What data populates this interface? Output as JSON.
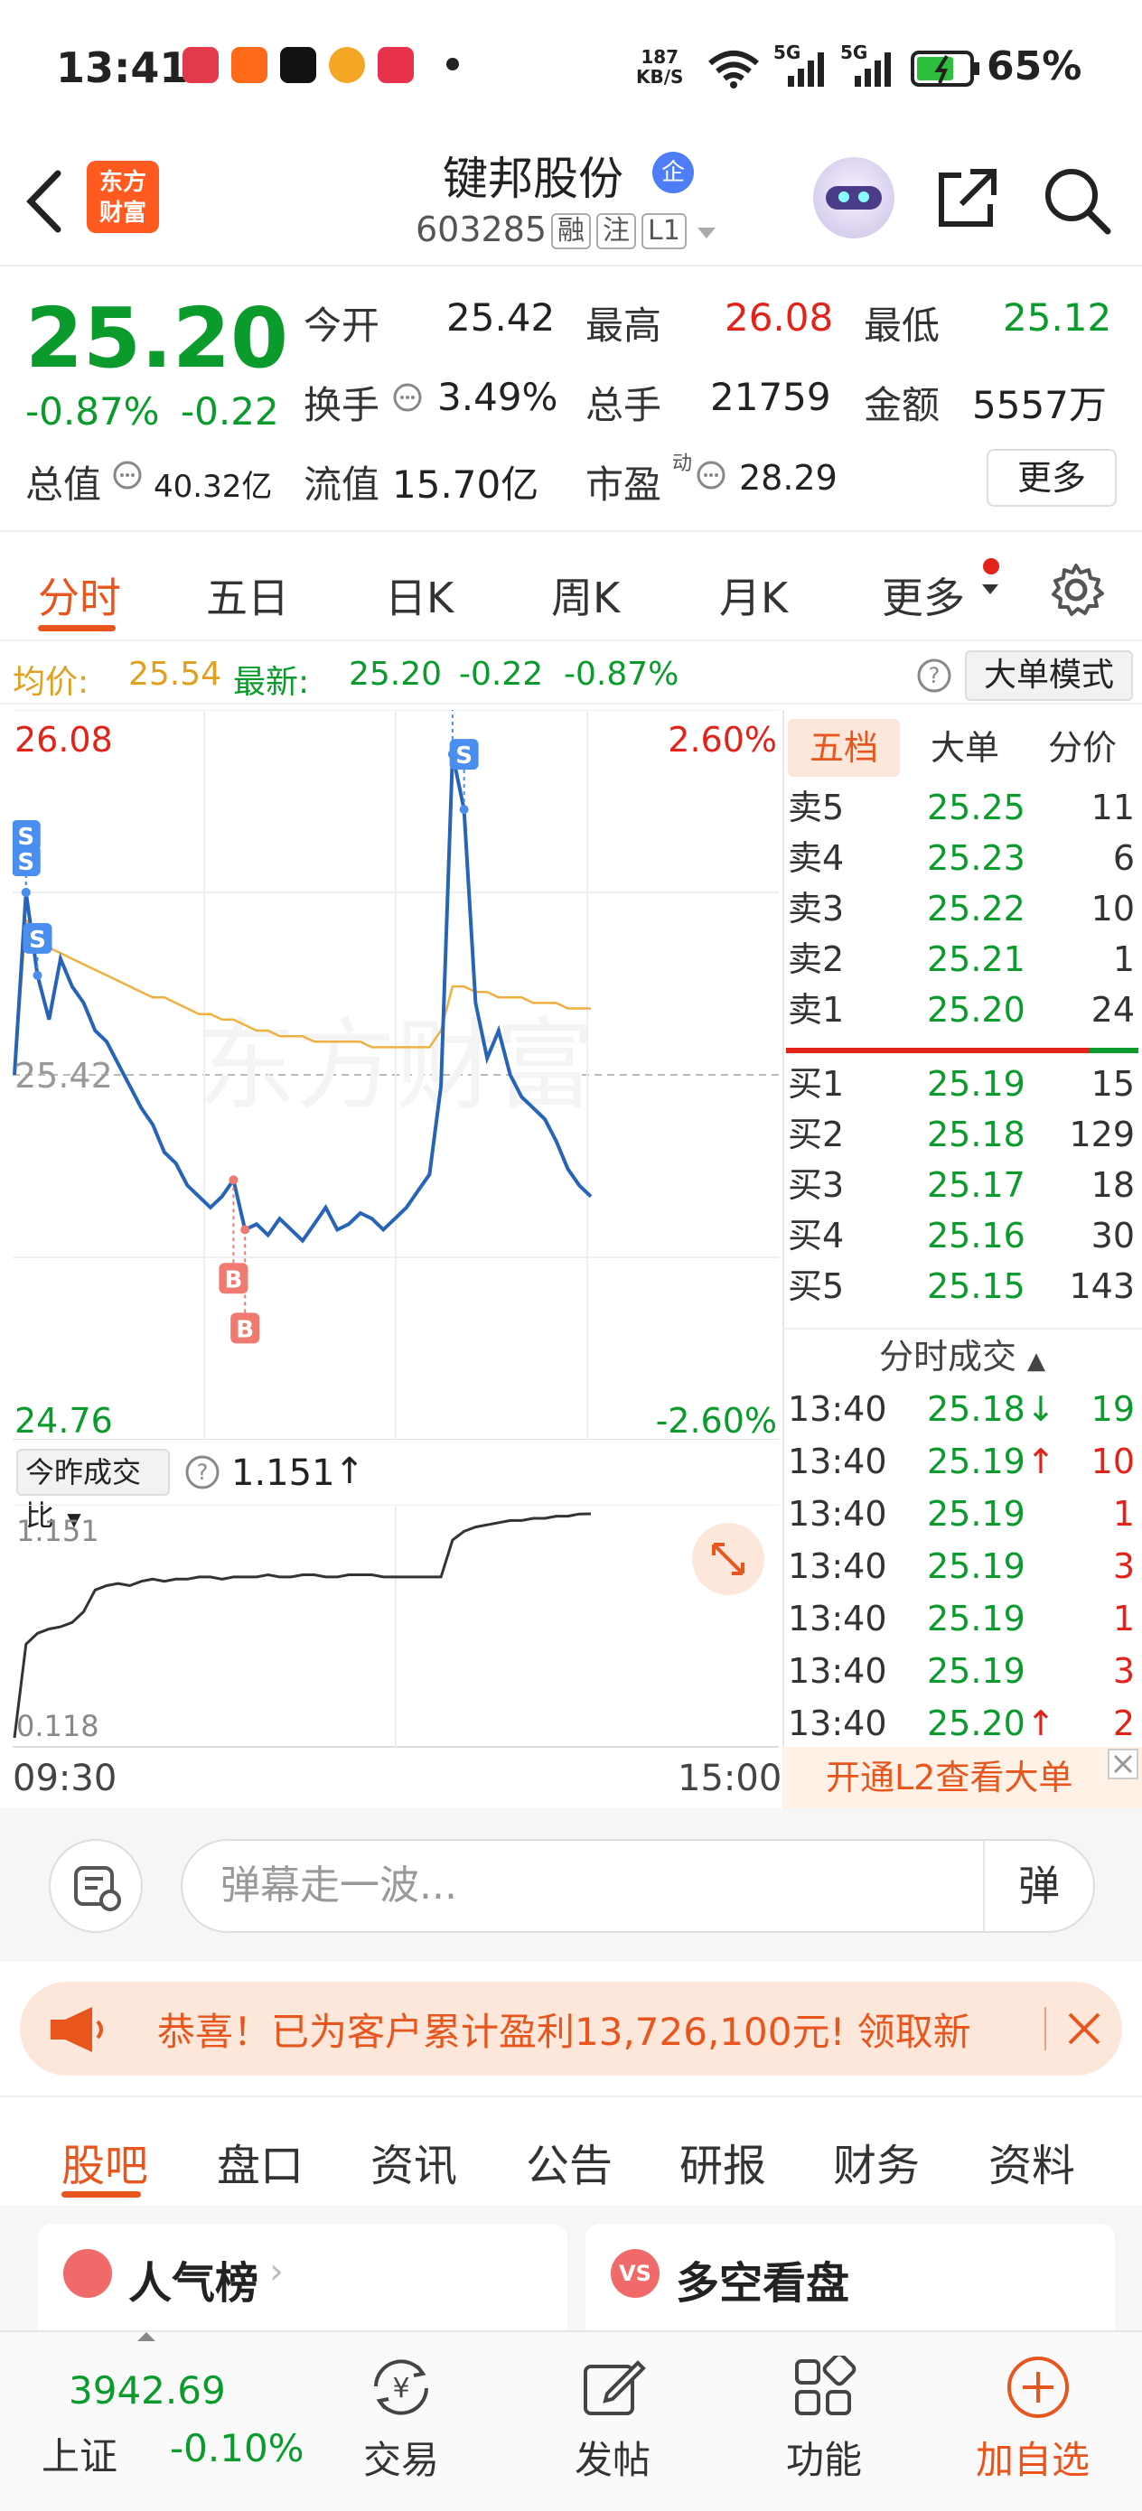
{
  "status_bar": {
    "time": "13:41",
    "net_speed": "187",
    "net_unit": "KB/S",
    "net_type_1": "5G",
    "net_type_2": "5G",
    "battery": "65%"
  },
  "header": {
    "logo_line1": "东方",
    "logo_line2": "财富",
    "stock_name": "键邦股份",
    "badge": "企",
    "stock_code": "603285",
    "tags": [
      "融",
      "注",
      "L1"
    ]
  },
  "quote": {
    "price": "25.20",
    "change_pct": "-0.87%",
    "change": "-0.22",
    "open_label": "今开",
    "open": "25.42",
    "high_label": "最高",
    "high": "26.08",
    "low_label": "最低",
    "low": "25.12",
    "turnover_label": "换手",
    "turnover": "3.49%",
    "volume_label": "总手",
    "volume": "21759",
    "amount_label": "金额",
    "amount": "5557万",
    "mcap_label": "总值",
    "mcap": "40.32亿",
    "float_label": "流值",
    "float_value": "15.70亿",
    "pe_label": "市盈",
    "pe_sup": "动",
    "pe": "28.29",
    "more_button": "更多"
  },
  "chart_tabs": [
    "分时",
    "五日",
    "日K",
    "周K",
    "月K",
    "更多"
  ],
  "avg_bar": {
    "avg_label": "均价:",
    "avg_value": "25.54",
    "latest_label": "最新:",
    "latest_value": "25.20",
    "latest_change": "-0.22",
    "latest_pct": "-0.87%",
    "mode_button": "大单模式"
  },
  "chart_data": [
    {
      "type": "line",
      "y_left_labels": {
        "top": "26.08",
        "mid": "25.42",
        "bottom": "24.76"
      },
      "y_right_labels": {
        "top": "2.60%",
        "bottom": "-2.60%"
      },
      "ylim": [
        24.76,
        26.08
      ],
      "x_labels": [
        "09:30",
        "15:00"
      ],
      "watermark": "东方财富",
      "series": [
        {
          "name": "price",
          "color": "#2764b8",
          "values": [
            25.42,
            25.75,
            25.6,
            25.52,
            25.63,
            25.58,
            25.55,
            25.5,
            25.48,
            25.44,
            25.4,
            25.36,
            25.33,
            25.28,
            25.26,
            25.22,
            25.2,
            25.18,
            25.2,
            25.23,
            25.14,
            25.15,
            25.13,
            25.16,
            25.14,
            25.12,
            25.15,
            25.18,
            25.14,
            25.15,
            25.17,
            25.16,
            25.14,
            25.16,
            25.18,
            25.21,
            25.24,
            25.4,
            26.0,
            25.9,
            25.55,
            25.45,
            25.5,
            25.42,
            25.38,
            25.36,
            25.34,
            25.3,
            25.25,
            25.22,
            25.2
          ]
        },
        {
          "name": "avg",
          "color": "#f0b040",
          "values": [
            25.42,
            25.7,
            25.68,
            25.65,
            25.64,
            25.63,
            25.62,
            25.61,
            25.6,
            25.59,
            25.58,
            25.57,
            25.56,
            25.56,
            25.55,
            25.54,
            25.53,
            25.53,
            25.52,
            25.52,
            25.51,
            25.5,
            25.5,
            25.49,
            25.49,
            25.49,
            25.48,
            25.48,
            25.48,
            25.48,
            25.48,
            25.47,
            25.47,
            25.47,
            25.47,
            25.47,
            25.47,
            25.5,
            25.58,
            25.58,
            25.57,
            25.57,
            25.56,
            25.56,
            25.56,
            25.55,
            25.55,
            25.55,
            25.54,
            25.54,
            25.54
          ]
        }
      ],
      "markers": [
        {
          "label": "S",
          "color": "#4a8ef0"
        },
        {
          "label": "S",
          "color": "#4a8ef0"
        },
        {
          "label": "S",
          "color": "#4a8ef0"
        },
        {
          "label": "S",
          "color": "#4a8ef0"
        },
        {
          "label": "S",
          "color": "#4a8ef0"
        },
        {
          "label": "B",
          "color": "#f07a70"
        },
        {
          "label": "B",
          "color": "#f07a70"
        }
      ]
    },
    {
      "type": "line",
      "title": "今昨成交比",
      "current": "1.151",
      "y_labels": {
        "top": "1.151",
        "bottom": "0.118"
      },
      "series": [
        {
          "name": "ratio",
          "color": "#333333",
          "values": [
            0.118,
            0.55,
            0.6,
            0.62,
            0.63,
            0.65,
            0.7,
            0.8,
            0.82,
            0.83,
            0.82,
            0.84,
            0.85,
            0.84,
            0.85,
            0.85,
            0.86,
            0.86,
            0.85,
            0.86,
            0.86,
            0.86,
            0.87,
            0.86,
            0.86,
            0.87,
            0.87,
            0.86,
            0.86,
            0.87,
            0.87,
            0.87,
            0.86,
            0.86,
            0.86,
            0.86,
            0.86,
            0.86,
            1.03,
            1.07,
            1.09,
            1.1,
            1.11,
            1.12,
            1.12,
            1.13,
            1.13,
            1.14,
            1.14,
            1.15,
            1.151
          ]
        }
      ]
    }
  ],
  "order_book": {
    "tabs": [
      "五档",
      "大单",
      "分价"
    ],
    "asks": [
      {
        "label": "卖5",
        "price": "25.25",
        "qty": "11"
      },
      {
        "label": "卖4",
        "price": "25.23",
        "qty": "6"
      },
      {
        "label": "卖3",
        "price": "25.22",
        "qty": "10"
      },
      {
        "label": "卖2",
        "price": "25.21",
        "qty": "1"
      },
      {
        "label": "卖1",
        "price": "25.20",
        "qty": "24"
      }
    ],
    "bids": [
      {
        "label": "买1",
        "price": "25.19",
        "qty": "15"
      },
      {
        "label": "买2",
        "price": "25.18",
        "qty": "129"
      },
      {
        "label": "买3",
        "price": "25.17",
        "qty": "18"
      },
      {
        "label": "买4",
        "price": "25.16",
        "qty": "30"
      },
      {
        "label": "买5",
        "price": "25.15",
        "qty": "143"
      }
    ],
    "trades_header": "分时成交",
    "trades": [
      {
        "time": "13:40",
        "price": "25.18",
        "arrow": "↓",
        "qty": "19"
      },
      {
        "time": "13:40",
        "price": "25.19",
        "arrow": "↑",
        "qty": "10"
      },
      {
        "time": "13:40",
        "price": "25.19",
        "arrow": "",
        "qty": "1"
      },
      {
        "time": "13:40",
        "price": "25.19",
        "arrow": "",
        "qty": "3"
      },
      {
        "time": "13:40",
        "price": "25.19",
        "arrow": "",
        "qty": "1"
      },
      {
        "time": "13:40",
        "price": "25.19",
        "arrow": "",
        "qty": "3"
      },
      {
        "time": "13:40",
        "price": "25.20",
        "arrow": "↑",
        "qty": "2"
      }
    ],
    "l2_banner": "开通L2查看大单"
  },
  "comment_bar": {
    "placeholder": "弹幕走一波...",
    "danmu_label": "弹"
  },
  "promo": {
    "text": "恭喜！已为客户累计盈利13,726,100元! 领取新"
  },
  "section_tabs": [
    "股吧",
    "盘口",
    "资讯",
    "公告",
    "研报",
    "财务",
    "资料"
  ],
  "cards": [
    {
      "title": "人气榜"
    },
    {
      "title": "多空看盘"
    }
  ],
  "bottom_nav": {
    "index_value": "3942.69",
    "index_name": "上证",
    "index_change": "-0.10%",
    "items": [
      "交易",
      "发帖",
      "功能",
      "加自选"
    ]
  },
  "colors": {
    "accent": "#e8561e",
    "up": "#e2231a",
    "down": "#0a9b2c",
    "price_line": "#2764b8",
    "avg_line": "#f0b040"
  }
}
